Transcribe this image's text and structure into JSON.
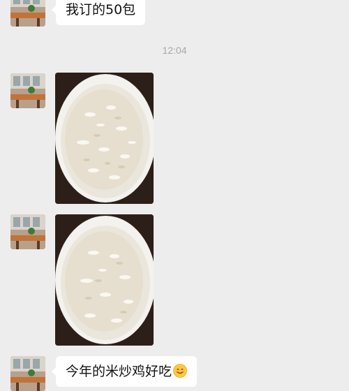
{
  "chat": {
    "messages": [
      {
        "type": "text",
        "text": "我订的50包"
      },
      {
        "type": "timestamp",
        "text": "12:04"
      },
      {
        "type": "image",
        "icon": "rice-bowl-photo"
      },
      {
        "type": "image",
        "icon": "rice-bowl-photo"
      },
      {
        "type": "text",
        "text": "今年的米炒鸡好吃",
        "emoji": "smile-emoji"
      }
    ]
  },
  "colors": {
    "background": "#ededed",
    "bubble": "#ffffff",
    "timestamp_text": "#a8a8a8"
  }
}
